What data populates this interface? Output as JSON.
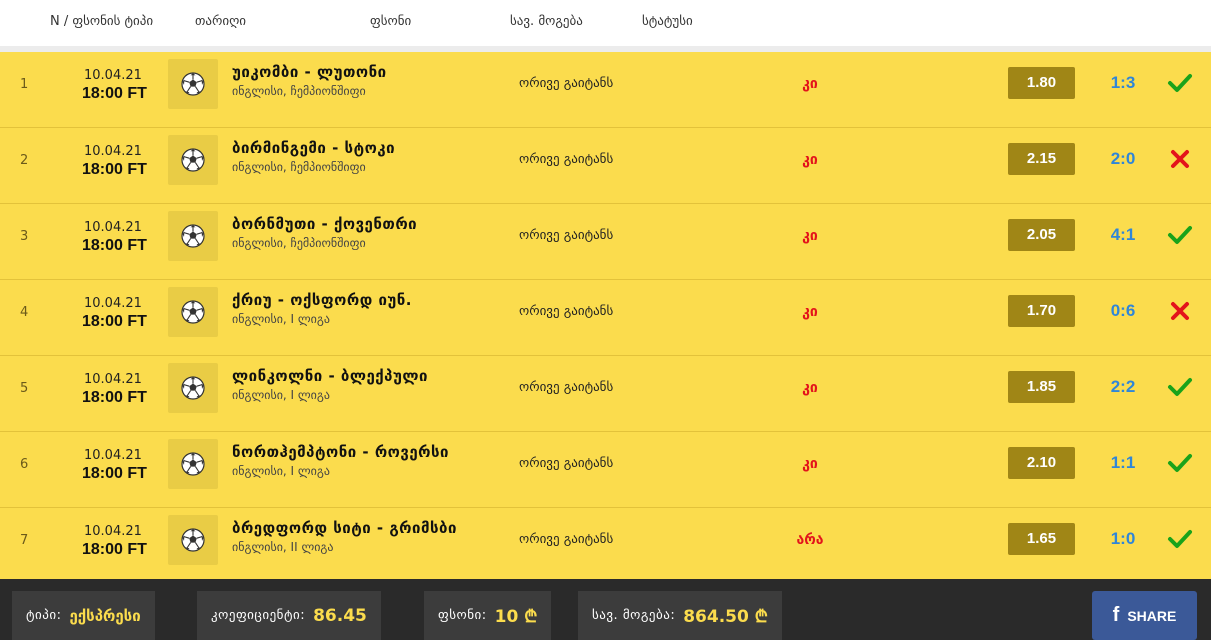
{
  "header": {
    "col_n": "N / ფსონის ტიპი",
    "col_date": "თარიღი",
    "col_bet": "ფსონი",
    "col_win": "სავ. მოგება",
    "col_status": "სტატუსი"
  },
  "rows": [
    {
      "n": "1",
      "date": "10.04.21",
      "time": "18:00 FT",
      "match": "უიკომბი - ლუთონი",
      "league": "ინგლისი, ჩემპიონშიფი",
      "bet": "ორივე გაიტანს",
      "answer": "კი",
      "odds": "1.80",
      "score": "1:3",
      "status": "win"
    },
    {
      "n": "2",
      "date": "10.04.21",
      "time": "18:00 FT",
      "match": "ბირმინგემი - სტოკი",
      "league": "ინგლისი, ჩემპიონშიფი",
      "bet": "ორივე გაიტანს",
      "answer": "კი",
      "odds": "2.15",
      "score": "2:0",
      "status": "loss"
    },
    {
      "n": "3",
      "date": "10.04.21",
      "time": "18:00 FT",
      "match": "ბორნმუთი - ქოვენთრი",
      "league": "ინგლისი, ჩემპიონშიფი",
      "bet": "ორივე გაიტანს",
      "answer": "კი",
      "odds": "2.05",
      "score": "4:1",
      "status": "win"
    },
    {
      "n": "4",
      "date": "10.04.21",
      "time": "18:00 FT",
      "match": "ქრიუ - ოქსფორდ იუნ.",
      "league": "ინგლისი, I ლიგა",
      "bet": "ორივე გაიტანს",
      "answer": "კი",
      "odds": "1.70",
      "score": "0:6",
      "status": "loss"
    },
    {
      "n": "5",
      "date": "10.04.21",
      "time": "18:00 FT",
      "match": "ლინკოლნი - ბლექპული",
      "league": "ინგლისი, I ლიგა",
      "bet": "ორივე გაიტანს",
      "answer": "კი",
      "odds": "1.85",
      "score": "2:2",
      "status": "win"
    },
    {
      "n": "6",
      "date": "10.04.21",
      "time": "18:00 FT",
      "match": "ნორთჰემპტონი - როვერსი",
      "league": "ინგლისი, I ლიგა",
      "bet": "ორივე გაიტანს",
      "answer": "კი",
      "odds": "2.10",
      "score": "1:1",
      "status": "win"
    },
    {
      "n": "7",
      "date": "10.04.21",
      "time": "18:00 FT",
      "match": "ბრედფორდ სიტი - გრიმსბი",
      "league": "ინგლისი, II ლიგა",
      "bet": "ორივე გაიტანს",
      "answer": "არა",
      "odds": "1.65",
      "score": "1:0",
      "status": "win"
    }
  ],
  "footer": {
    "type_label": "ტიპი:",
    "type_value": "ექსპრესი",
    "coef_label": "კოეფიციენტი:",
    "coef_value": "86.45",
    "stake_label": "ფსონი:",
    "stake_value": "10 ₾",
    "win_label": "სავ. მოგება:",
    "win_value": "864.50 ₾",
    "share_label": "SHARE"
  },
  "icons": {
    "ball": "soccer-ball-icon",
    "win": "checkmark-icon",
    "loss": "cross-icon",
    "share": "facebook-icon"
  },
  "colors": {
    "row_bg": "#fbdc4d",
    "odds_bg": "#a08616",
    "score": "#2f86d8",
    "answer": "#e3141b",
    "win": "#1aa31a",
    "loss": "#e3141b",
    "footer_bg": "#2a2a2a",
    "facebook": "#3b5998"
  }
}
